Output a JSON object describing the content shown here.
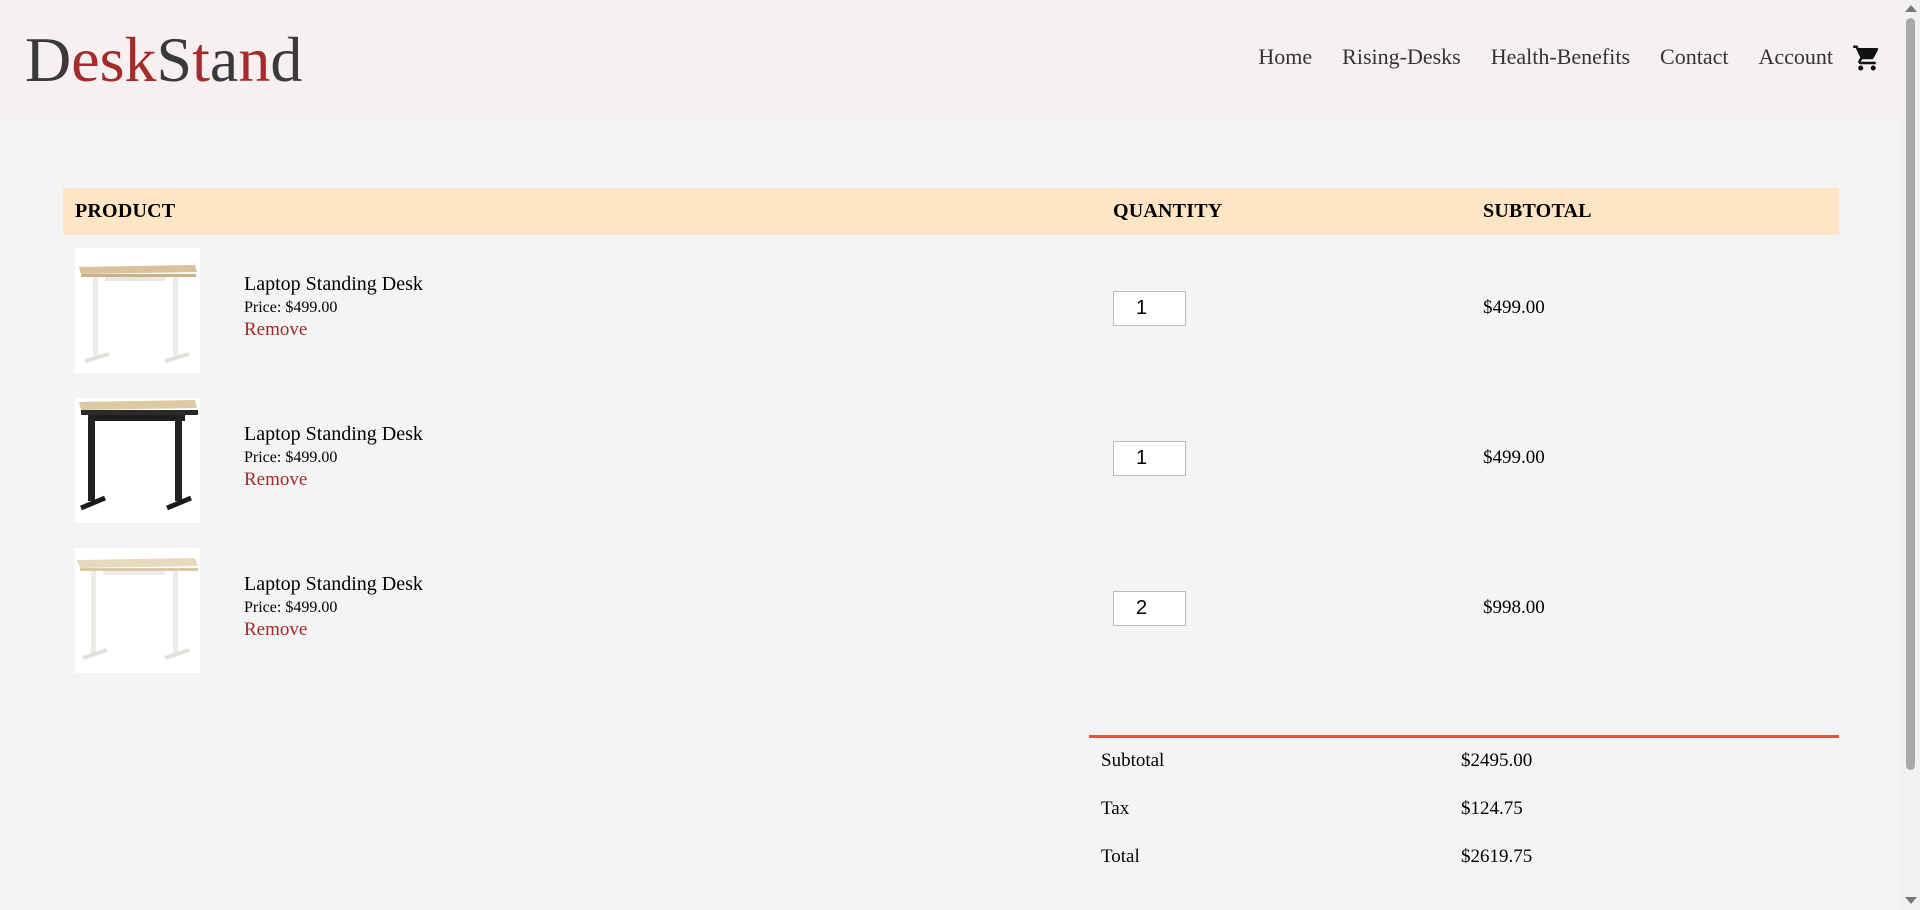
{
  "brand": {
    "letters": [
      "D",
      "e",
      "s",
      "k",
      "S",
      "t",
      "a",
      "n",
      "d"
    ],
    "colors": [
      "#3a3a3a",
      "#a52a2a",
      "#a52a2a",
      "#a52a2a",
      "#3a3a3a",
      "#a52a2a",
      "#3a3a3a",
      "#a52a2a",
      "#3a3a3a"
    ]
  },
  "nav": {
    "items": [
      "Home",
      "Rising-Desks",
      "Health-Benefits",
      "Contact",
      "Account"
    ],
    "cart_icon": "shopping-cart-icon"
  },
  "table": {
    "headers": {
      "product": "PRODUCT",
      "quantity": "QUANTITY",
      "subtotal": "SUBTOTAL"
    },
    "rows": [
      {
        "name": "Laptop Standing Desk",
        "price": "Price: $499.00",
        "remove": "Remove",
        "quantity": "1",
        "subtotal": "$499.00",
        "frame": "white"
      },
      {
        "name": "Laptop Standing Desk",
        "price": "Price: $499.00",
        "remove": "Remove",
        "quantity": "1",
        "subtotal": "$499.00",
        "frame": "black"
      },
      {
        "name": "Laptop Standing Desk",
        "price": "Price: $499.00",
        "remove": "Remove",
        "quantity": "2",
        "subtotal": "$998.00",
        "frame": "white"
      }
    ]
  },
  "totals": {
    "subtotal_label": "Subtotal",
    "subtotal_value": "$2495.00",
    "tax_label": "Tax",
    "tax_value": "$124.75",
    "total_label": "Total",
    "total_value": "$2619.75"
  },
  "colors": {
    "accent": "#a52a2a",
    "header_bg": "#ffe5c4",
    "divider": "#e0533e"
  }
}
